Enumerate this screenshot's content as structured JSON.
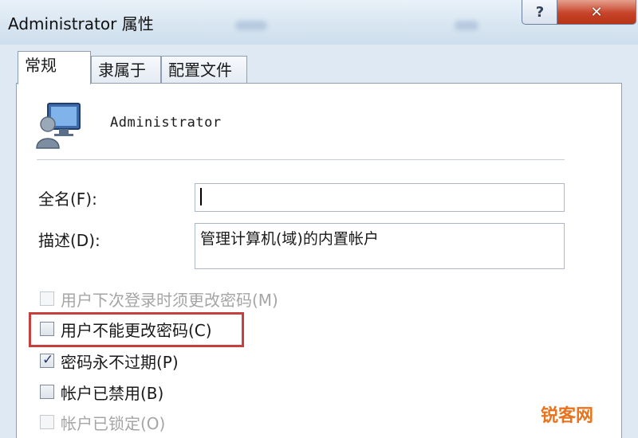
{
  "window": {
    "title": "Administrator 属性",
    "help_glyph": "?",
    "close_glyph": "✕"
  },
  "tabs": [
    {
      "label": "常规",
      "active": true
    },
    {
      "label": "隶属于",
      "active": false
    },
    {
      "label": "配置文件",
      "active": false
    }
  ],
  "account": {
    "icon": "user-computer-icon",
    "name": "Administrator"
  },
  "fields": {
    "fullname": {
      "label": "全名(F):",
      "value": ""
    },
    "description": {
      "label": "描述(D):",
      "value": "管理计算机(域)的内置帐户"
    }
  },
  "checkboxes": [
    {
      "label": "用户下次登录时须更改密码(M)",
      "checked": false,
      "disabled": true
    },
    {
      "label": "用户不能更改密码(C)",
      "checked": false,
      "disabled": false
    },
    {
      "label": "密码永不过期(P)",
      "checked": true,
      "disabled": false
    },
    {
      "label": "帐户已禁用(B)",
      "checked": false,
      "disabled": false
    },
    {
      "label": "帐户已锁定(O)",
      "checked": false,
      "disabled": true
    }
  ],
  "watermark": "锐客网",
  "colors": {
    "highlight": "#c64040",
    "close_button": "#c6432a",
    "watermark": "#e9731c"
  }
}
